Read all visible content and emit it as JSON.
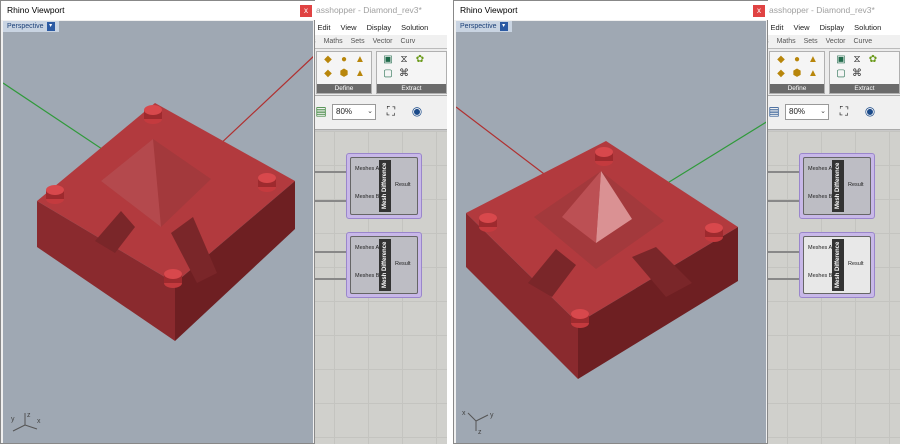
{
  "panels": [
    {
      "rhino": {
        "title": "Rhino Viewport",
        "close_label": "x",
        "viewport_label": "Perspective",
        "axis_labels": {
          "x": "x",
          "y": "y",
          "z": "z"
        }
      },
      "grasshopper": {
        "title": "asshopper - Diamond_rev3*",
        "menu": [
          "ile",
          "Edit",
          "View",
          "Display",
          "Solution"
        ],
        "tabs": [
          "rams",
          "Maths",
          "Sets",
          "Vector",
          "Curv"
        ],
        "ribbon_groups": [
          "Define",
          "Extract"
        ],
        "zoom": "80%",
        "nodes": [
          {
            "title": "Mesh Difference",
            "input_a": "Meshes A",
            "input_b": "Meshes B",
            "output": "Result",
            "selected": true
          },
          {
            "title": "Mesh Difference",
            "input_a": "Meshes A",
            "input_b": "Meshes B",
            "output": "Result",
            "selected": true
          }
        ]
      }
    },
    {
      "rhino": {
        "title": "Rhino Viewport",
        "close_label": "x",
        "viewport_label": "Perspective",
        "axis_labels": {
          "x": "x",
          "y": "y",
          "z": "z"
        }
      },
      "grasshopper": {
        "title": "asshopper - Diamond_rev3*",
        "menu": [
          "ile",
          "Edit",
          "View",
          "Display",
          "Solution"
        ],
        "tabs": [
          "rams",
          "Maths",
          "Sets",
          "Vector",
          "Curve"
        ],
        "ribbon_groups": [
          "Define",
          "Extract"
        ],
        "zoom": "80%",
        "nodes": [
          {
            "title": "Mesh Difference",
            "input_a": "Meshes A",
            "input_b": "Meshes B",
            "output": "Result",
            "selected": true
          },
          {
            "title": "Mesh Difference",
            "input_a": "Meshes A",
            "input_b": "Meshes B",
            "output": "Result",
            "selected": true
          }
        ]
      }
    }
  ],
  "colors": {
    "viewport_bg": "#9fa8b3",
    "mold_top": "#b23a3e",
    "mold_side_left": "#8a2a2e",
    "mold_side_right": "#6e1f22",
    "node_selected": "#c8b8e8",
    "axis_red": "#b03030",
    "axis_green": "#2f9a3a"
  }
}
